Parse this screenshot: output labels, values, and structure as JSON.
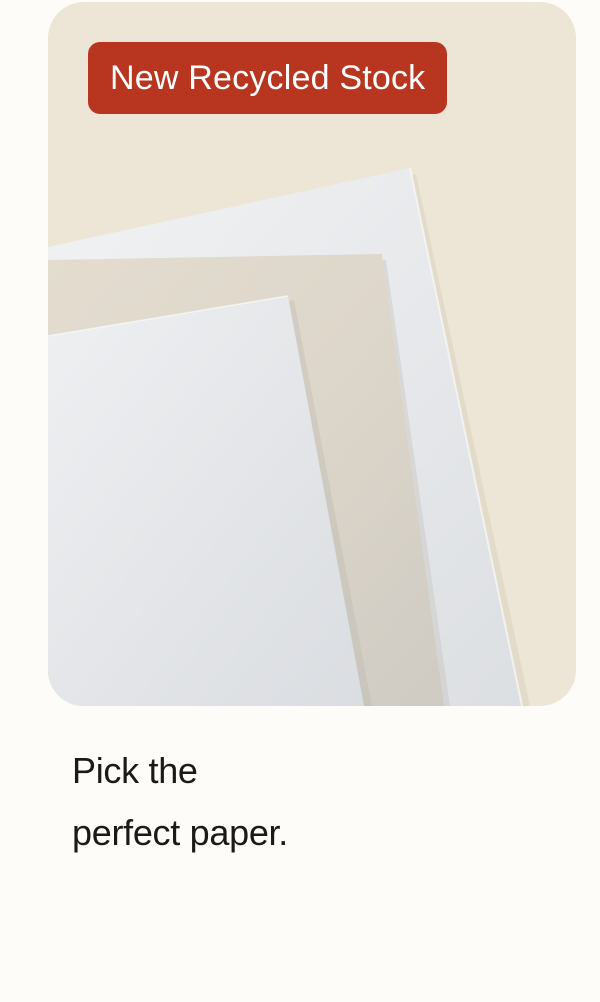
{
  "promo_card": {
    "badge_text": "New Recycled Stock",
    "badge_color": "#b8361f",
    "card_background": "#ede6d6",
    "image_subject": "stacked paper samples",
    "headline_line1": "Pick the",
    "headline_line2": "perfect paper."
  }
}
